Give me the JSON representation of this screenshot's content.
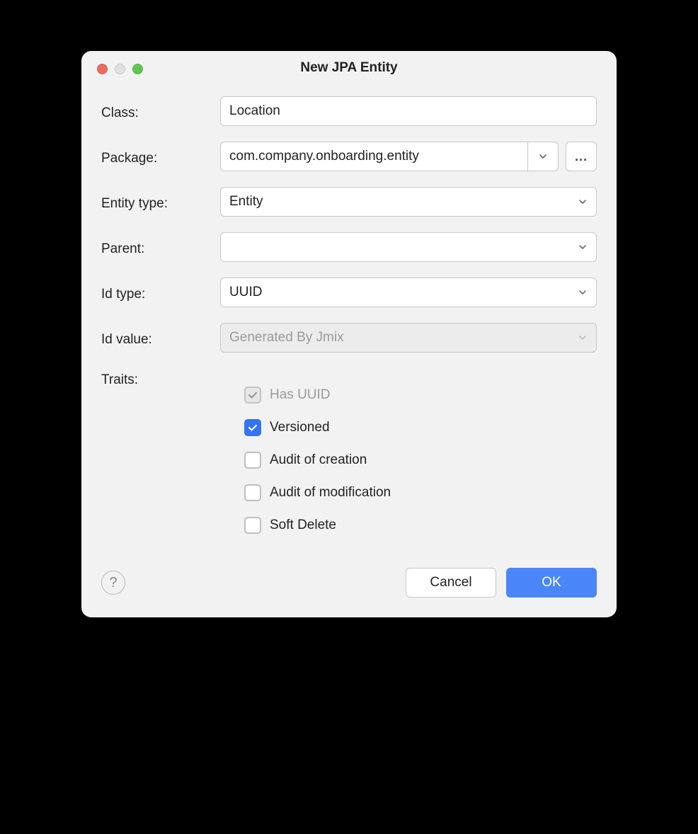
{
  "title": "New JPA Entity",
  "labels": {
    "class": "Class:",
    "package": "Package:",
    "entity_type": "Entity type:",
    "parent": "Parent:",
    "id_type": "Id type:",
    "id_value": "Id value:",
    "traits": "Traits:"
  },
  "values": {
    "class": "Location",
    "package": "com.company.onboarding.entity",
    "entity_type": "Entity",
    "parent": "",
    "id_type": "UUID",
    "id_value": "Generated By Jmix"
  },
  "browse_label": "...",
  "traits": [
    {
      "label": "Has UUID",
      "checked": true,
      "disabled": true
    },
    {
      "label": "Versioned",
      "checked": true,
      "disabled": false
    },
    {
      "label": "Audit of creation",
      "checked": false,
      "disabled": false
    },
    {
      "label": "Audit of modification",
      "checked": false,
      "disabled": false
    },
    {
      "label": "Soft Delete",
      "checked": false,
      "disabled": false
    }
  ],
  "buttons": {
    "help": "?",
    "cancel": "Cancel",
    "ok": "OK"
  }
}
